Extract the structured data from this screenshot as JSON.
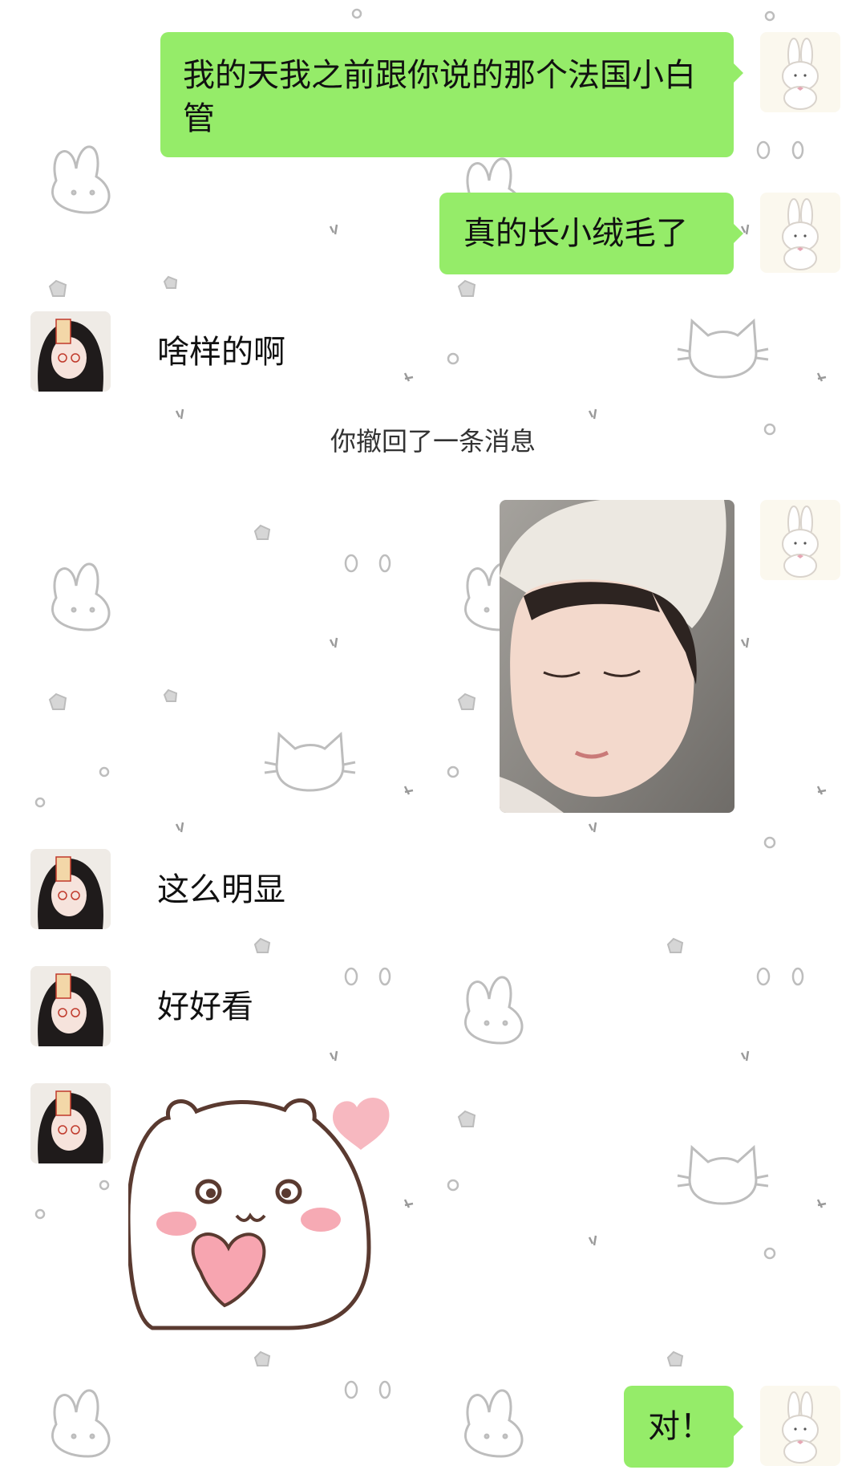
{
  "colors": {
    "sent_bubble": "#95ec69",
    "text": "#111111",
    "system_text": "#333333",
    "background": "#ffffff"
  },
  "messages": [
    {
      "side": "sent",
      "text": "我的天我之前跟你说的那个法国小白管"
    },
    {
      "side": "sent",
      "text": "真的长小绒毛了"
    },
    {
      "side": "received",
      "text": "啥样的啊"
    },
    {
      "type": "system",
      "text": "你撤回了一条消息"
    },
    {
      "side": "sent",
      "type": "image",
      "icon": "photo-girl-with-towel"
    },
    {
      "side": "received",
      "text": "这么明显"
    },
    {
      "side": "received",
      "text": "好好看"
    },
    {
      "side": "received",
      "type": "sticker",
      "icon": "bear-holding-heart-sticker"
    },
    {
      "side": "sent",
      "text": "对！"
    }
  ]
}
